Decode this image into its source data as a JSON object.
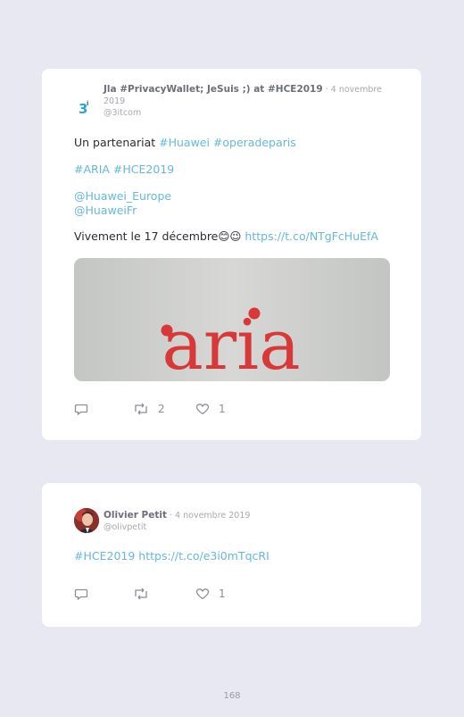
{
  "tweets": [
    {
      "author": "Jla #PrivacyWallet; JeSuis ;) at #HCE2019",
      "date": "· 4 novembre 2019",
      "handle": "@3itcom",
      "avatar_text": "3",
      "lines": [
        {
          "plain": "Un partenariat ",
          "links": "#Huawei #operadeparis"
        },
        {
          "plain": "",
          "links": "#ARIA #HCE2019"
        },
        {
          "plain": "",
          "links": "@Huawei_Europe"
        },
        {
          "plain": "",
          "links": "@HuaweiFr"
        },
        {
          "plain": "Vivement le 17 décembre😊😉 ",
          "links": "https://t.co/NTgFcHuEfA"
        }
      ],
      "media_logo": "aria",
      "reply_count": "",
      "retweet_count": "2",
      "like_count": "1"
    },
    {
      "author": "Olivier Petit",
      "date": "· 4 novembre 2019",
      "handle": "@olivpetit",
      "lines": [
        {
          "plain": "",
          "links": "#HCE2019 https://t.co/e3i0mTqcRI"
        }
      ],
      "reply_count": "",
      "retweet_count": "",
      "like_count": "1"
    }
  ],
  "page_number": "168",
  "colors": {
    "background": "#e8e8f2",
    "card": "#ffffff",
    "link": "#65b8dc",
    "logo_red": "#d8383a"
  },
  "icons": [
    "reply-icon",
    "retweet-icon",
    "like-icon"
  ]
}
